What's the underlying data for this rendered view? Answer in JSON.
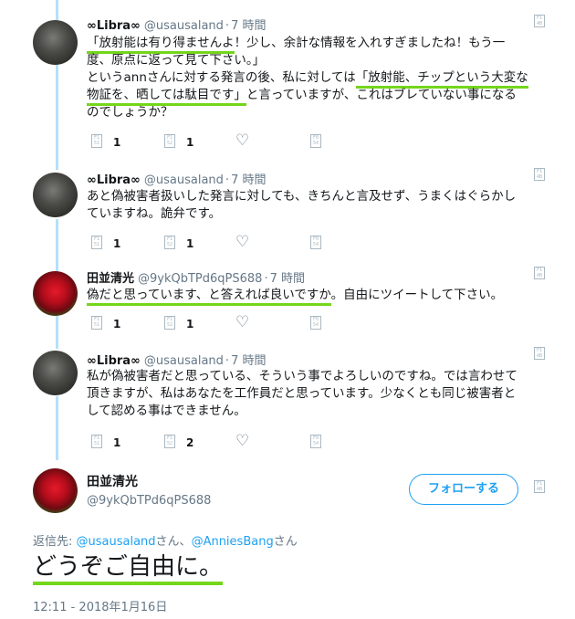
{
  "tweets": [
    {
      "name": "∞Libra∞",
      "handle": "@usausaland",
      "dot": "·",
      "time": "7 時間",
      "lines": [
        [
          "",
          "「放射能は有り得ませんよ",
          "！少し、余計な情報を入れすぎましたね！もう一"
        ],
        [
          "度、原点に返って見て下さい。」",
          "",
          ""
        ],
        [
          "というannさんに対する発言の後、私に対しては",
          "「放射能、チップという大変な",
          ""
        ],
        [
          "",
          "物証を、晒しては駄目です」",
          "と言っていますが、これはブレていない事になる"
        ],
        [
          "のでしょうか？",
          "",
          ""
        ]
      ],
      "counts": {
        "reply": "1",
        "retweet": "1",
        "like": ""
      }
    },
    {
      "name": "∞Libra∞",
      "handle": "@usausaland",
      "dot": "·",
      "time": "7 時間",
      "lines": [
        [
          "あと偽被害者扱いした発言に対しても、きちんと言及せず、うまくはぐらかし",
          "",
          ""
        ],
        [
          "ていますね。詭弁です。",
          "",
          ""
        ]
      ],
      "counts": {
        "reply": "1",
        "retweet": "1",
        "like": ""
      }
    },
    {
      "name": "田並清光",
      "handle": "@9ykQbTPd6qPS688",
      "dot": "·",
      "time": "7 時間",
      "lines": [
        [
          "",
          "偽だと思っています、と答えれば良いですか",
          "。自由にツイートして下さい。"
        ]
      ],
      "counts": {
        "reply": "1",
        "retweet": "1",
        "like": ""
      }
    },
    {
      "name": "∞Libra∞",
      "handle": "@usausaland",
      "dot": "·",
      "time": "7 時間",
      "lines": [
        [
          "私が偽被害者だと思っている、そういう事でよろしいのですね。では言わせて",
          "",
          ""
        ],
        [
          "頂きますが、私はあなたを工作員だと思っています。少なくとも同じ被害者と",
          "",
          ""
        ],
        [
          "して認める事はできません。",
          "",
          ""
        ]
      ],
      "counts": {
        "reply": "1",
        "retweet": "2",
        "like": ""
      }
    }
  ],
  "main": {
    "name": "田並清光",
    "handle": "@9ykQbTPd6qPS688",
    "follow_label": "フォローする",
    "replying_prefix": "返信先: ",
    "reply_to_1": "@usausaland",
    "reply_mid": "さん、",
    "reply_to_2": "@AnniesBang",
    "reply_suffix": "さん",
    "text": "どうぞご自由に。",
    "timestamp": "12:11 - 2018年1月16日"
  },
  "icons": {
    "caret": "caret-down-icon",
    "reply": "reply-icon",
    "retweet": "retweet-icon",
    "like": "heart-icon",
    "dm": "direct-message-icon"
  },
  "colors": {
    "accent": "#1da1f2",
    "thread_line": "#b3e0fb",
    "highlight": "#74d61a",
    "muted": "#657786"
  }
}
